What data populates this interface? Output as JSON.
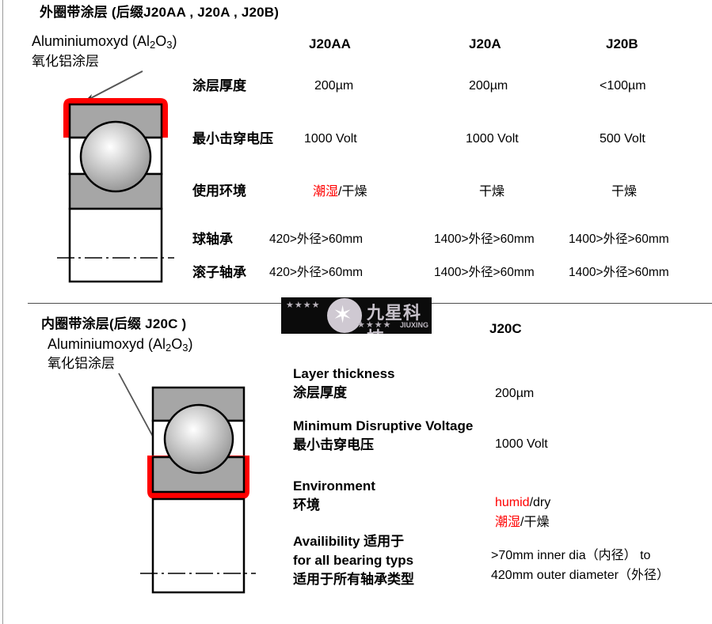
{
  "section_outer": {
    "title": "外圈带涂层 (后缀J20AA , J20A , J20B)",
    "material_en": "Aluminiumoxyd (Al",
    "material_sub1": "2",
    "material_mid": "O",
    "material_sub2": "3",
    "material_end": ")",
    "material_cn": "氧化铝涂层",
    "columns": [
      "J20AA",
      "J20A",
      "J20B"
    ],
    "rows": [
      {
        "label": "涂层厚度",
        "values": [
          "200µm",
          "200µm",
          "<100µm"
        ]
      },
      {
        "label": "最小击穿电压",
        "values": [
          "1000 Volt",
          "1000 Volt",
          "500 Volt"
        ]
      },
      {
        "label": "使用环境",
        "values_red": [
          "潮湿",
          "",
          ""
        ],
        "values_sep": [
          "/",
          "",
          ""
        ],
        "values": [
          "干燥",
          "干燥",
          "干燥"
        ]
      },
      {
        "label": "球轴承",
        "values": [
          "420>外径>60mm",
          "1400>外径>60mm",
          "1400>外径>60mm"
        ]
      },
      {
        "label": "滚子轴承",
        "values": [
          "420>外径>60mm",
          "1400>外径>60mm",
          "1400>外径>60mm"
        ]
      }
    ]
  },
  "section_inner": {
    "title": "内圈带涂层(后缀 J20C )",
    "material_en": "Aluminiumoxyd (Al",
    "material_sub1": "2",
    "material_mid": "O",
    "material_sub2": "3",
    "material_end": ")",
    "material_cn": "氧化铝涂层",
    "column": "J20C",
    "blocks": [
      {
        "label_en": "Layer thickness",
        "label_cn": "涂层厚度",
        "value": "200µm"
      },
      {
        "label_en": "Minimum Disruptive Voltage",
        "label_cn": "最小击穿电压",
        "value": "1000 Volt"
      },
      {
        "label_en": "Environment",
        "label_cn": "环境",
        "value_en_red": "humid",
        "value_en_rest": "/dry",
        "value_cn_red": "潮湿",
        "value_cn_rest": "/干燥"
      },
      {
        "label_en": "Availibility  适用于",
        "label_en2": "for all bearing typs",
        "label_cn": "适用于所有轴承类型",
        "value_line1": ">70mm inner dia（内径） to",
        "value_line2": "420mm outer diameter（外径）"
      }
    ]
  },
  "watermark": {
    "stars_top": "★★★★",
    "star_center": "✶",
    "brand_cn": "九星科技",
    "stars_bottom": "★★★★",
    "brand_sub": "JIUXING"
  },
  "colors": {
    "coating_red": "#ff0000",
    "ring_gray": "#a6a6a6",
    "outline": "#000000",
    "divider": "#4d4d4d"
  }
}
